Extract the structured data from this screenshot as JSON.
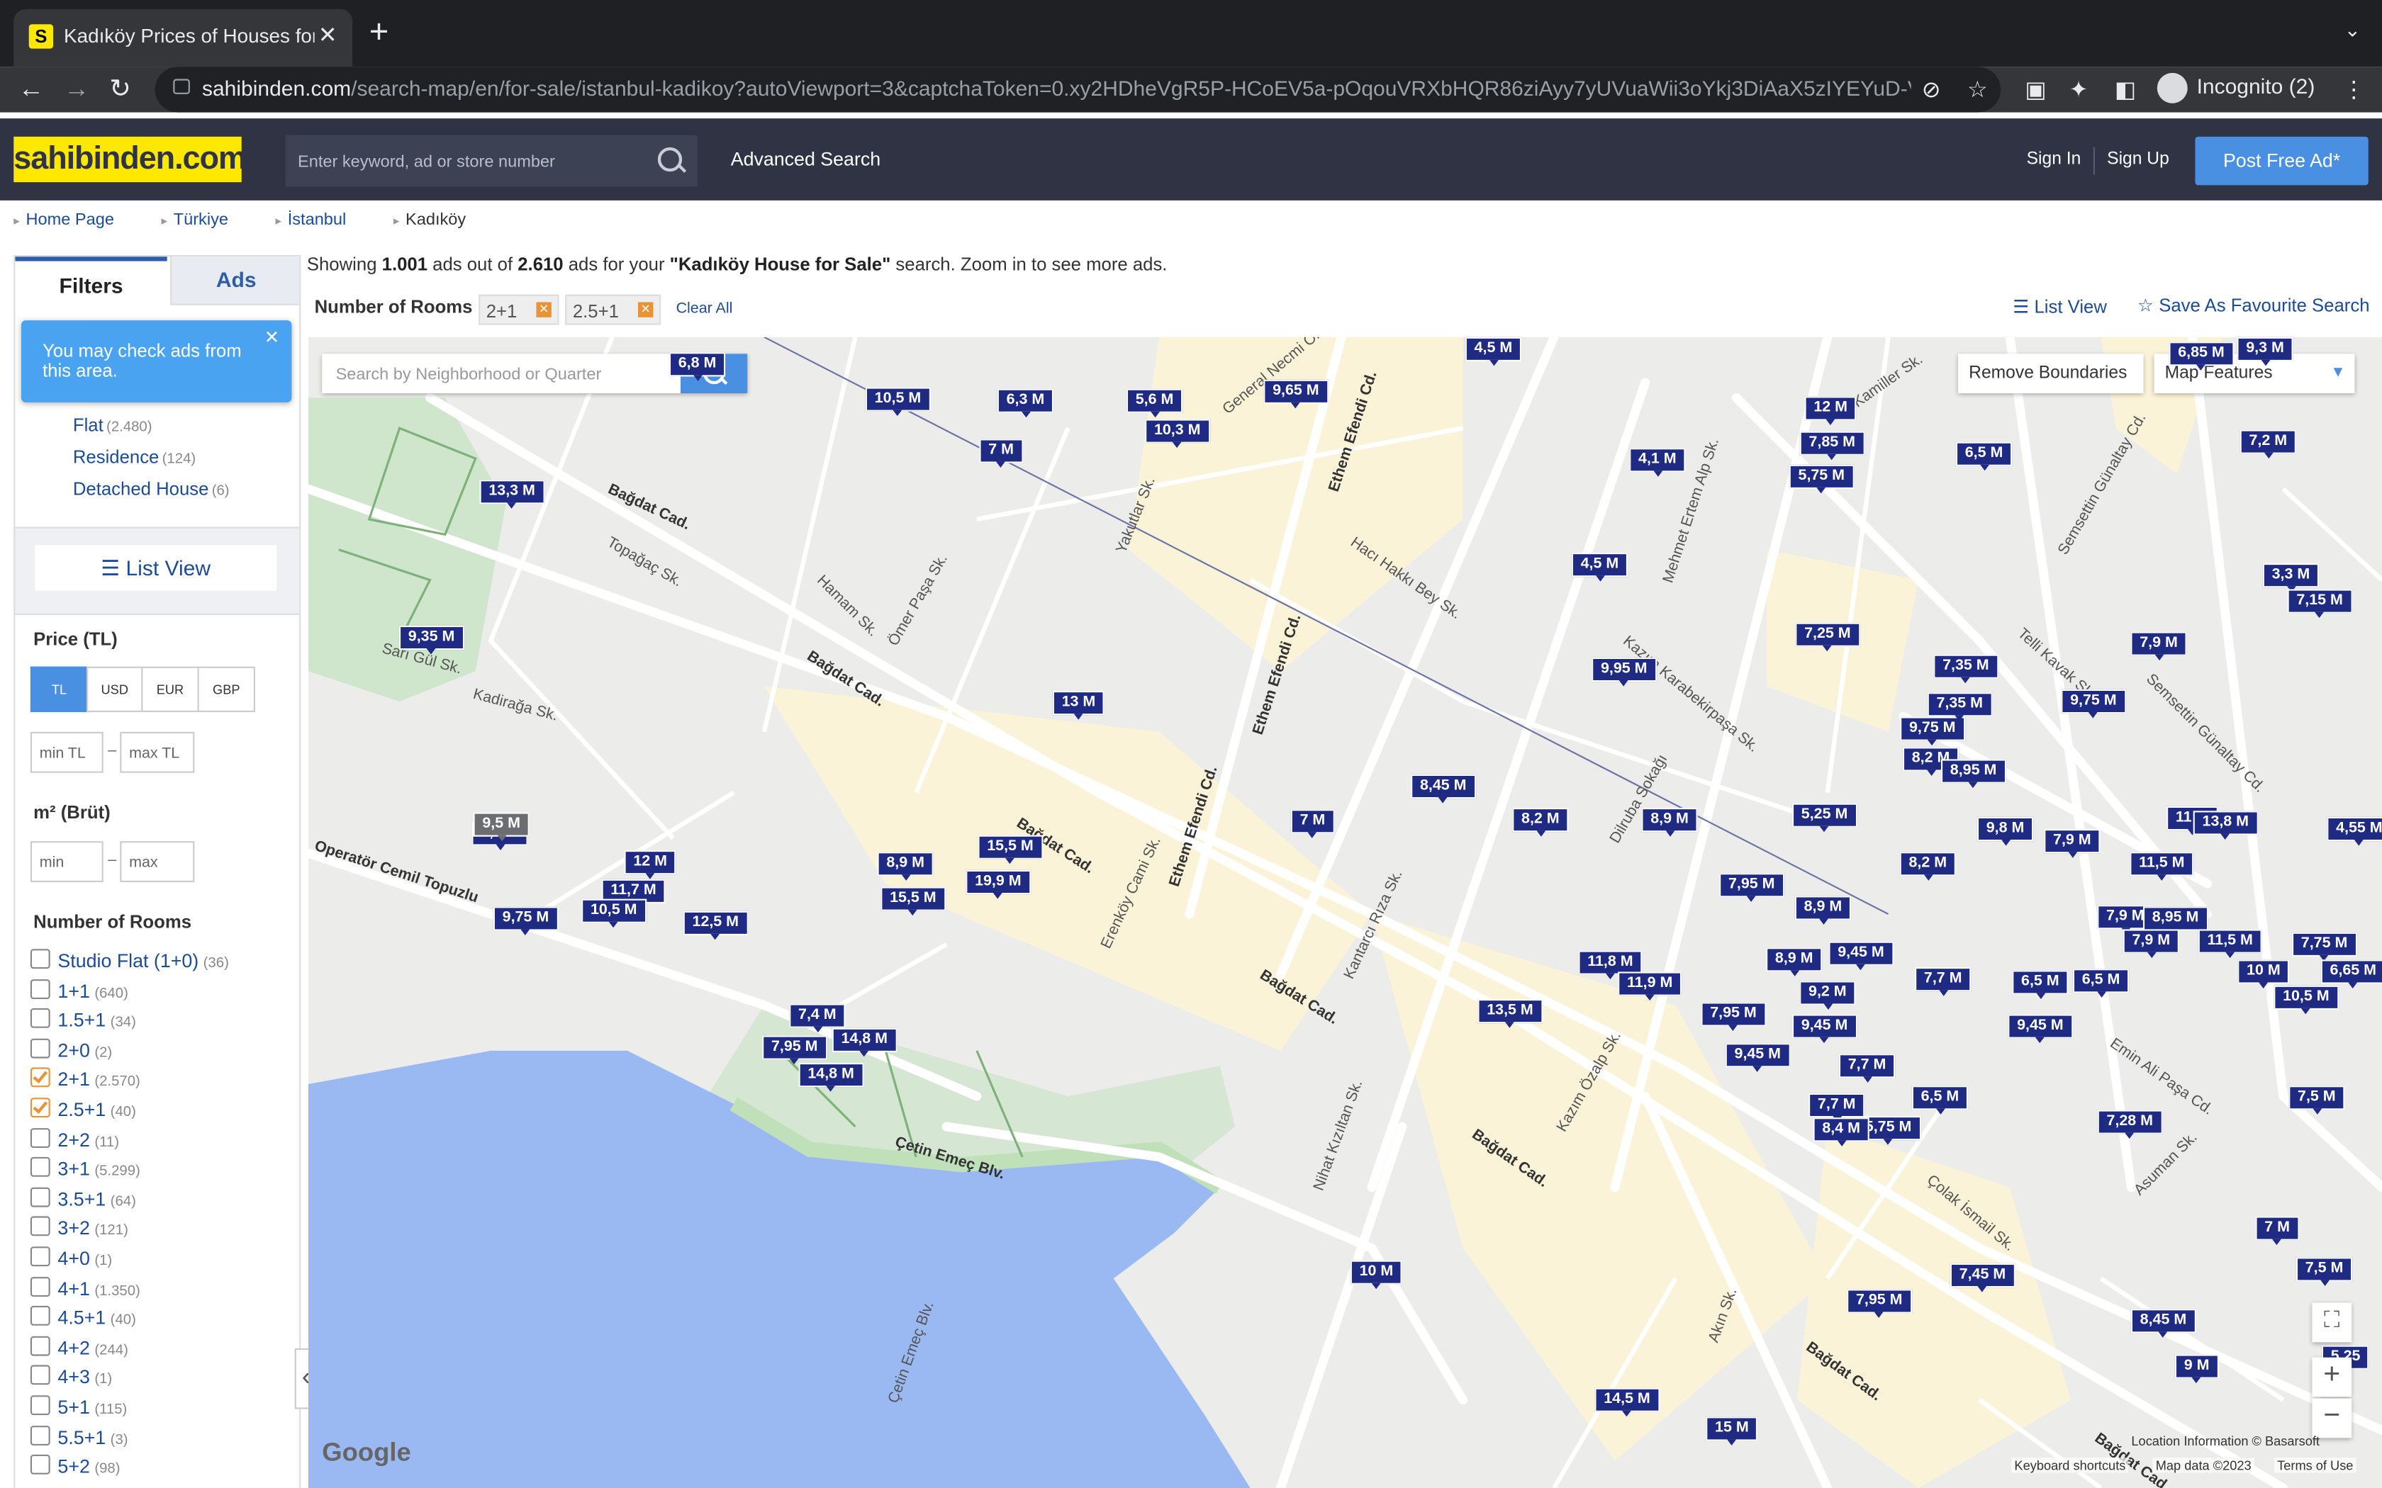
{
  "browser": {
    "tab_title": "Kadıköy Prices of Houses for Sale",
    "tab_favicon": "S",
    "url_domain": "sahibinden.com",
    "url_rest": "/search-map/en/for-sale/istanbul-kadikoy?autoViewport=3&captchaToken=0.xy2HDheVgR5P-HCoEV5a-pOqouVRXbHQR86ziAyy7yUVuaWii3oYkj3DiAaX5zIYEYuD-V...",
    "profile_label": "Incognito (2)"
  },
  "site": {
    "logo": "sahibinden.com",
    "search_placeholder": "Enter keyword, ad or store number",
    "advanced_search": "Advanced Search",
    "sign_in": "Sign In",
    "sign_up": "Sign Up",
    "post_ad": "Post Free Ad*",
    "brand_color": "#ffe800",
    "header_color": "#2f3344"
  },
  "breadcrumb": [
    "Home Page",
    "Türkiye",
    "İstanbul",
    "Kadıköy"
  ],
  "filters": {
    "tab_filters": "Filters",
    "tab_ads": "Ads",
    "tooltip": "You may check ads from this area.",
    "categories": [
      {
        "label": "Flat",
        "count": "(2.480)"
      },
      {
        "label": "Residence",
        "count": "(124)"
      },
      {
        "label": "Detached House",
        "count": "(6)"
      }
    ],
    "list_view": "List View",
    "price_label": "Price (TL)",
    "currencies": [
      "TL",
      "USD",
      "EUR",
      "GBP"
    ],
    "selected_currency": "TL",
    "min_tl": "min TL",
    "max_tl": "max TL",
    "area_label": "m² (Brüt)",
    "min": "min",
    "max": "max",
    "rooms_label": "Number of Rooms",
    "rooms": [
      {
        "label": "Studio Flat (1+0)",
        "count": "(36)",
        "checked": false
      },
      {
        "label": "1+1",
        "count": "(640)",
        "checked": false
      },
      {
        "label": "1.5+1",
        "count": "(34)",
        "checked": false
      },
      {
        "label": "2+0",
        "count": "(2)",
        "checked": false
      },
      {
        "label": "2+1",
        "count": "(2.570)",
        "checked": true
      },
      {
        "label": "2.5+1",
        "count": "(40)",
        "checked": true
      },
      {
        "label": "2+2",
        "count": "(11)",
        "checked": false
      },
      {
        "label": "3+1",
        "count": "(5.299)",
        "checked": false
      },
      {
        "label": "3.5+1",
        "count": "(64)",
        "checked": false
      },
      {
        "label": "3+2",
        "count": "(121)",
        "checked": false
      },
      {
        "label": "4+0",
        "count": "(1)",
        "checked": false
      },
      {
        "label": "4+1",
        "count": "(1.350)",
        "checked": false
      },
      {
        "label": "4.5+1",
        "count": "(40)",
        "checked": false
      },
      {
        "label": "4+2",
        "count": "(244)",
        "checked": false
      },
      {
        "label": "4+3",
        "count": "(1)",
        "checked": false
      },
      {
        "label": "5+1",
        "count": "(115)",
        "checked": false
      },
      {
        "label": "5.5+1",
        "count": "(3)",
        "checked": false
      },
      {
        "label": "5+2",
        "count": "(98)",
        "checked": false
      }
    ]
  },
  "results": {
    "showing_pre": "Showing ",
    "shown": "1.001",
    "mid1": " ads out of ",
    "total": "2.610",
    "mid2": " ads for your ",
    "query": "\"Kadıköy House for Sale\"",
    "post": " search. Zoom in to see more ads.",
    "rooms_filter_label": "Number of Rooms",
    "chips": [
      "2+1",
      "2.5+1"
    ],
    "clear_all": "Clear All",
    "list_view": "List View",
    "save_favourite": "Save As Favourite Search"
  },
  "map": {
    "search_placeholder": "Search by Neighborhood or Quarter",
    "remove_boundaries": "Remove Boundaries",
    "map_features": "Map Features",
    "google": "Google",
    "location_info": "Location Information © Basarsoft",
    "keyboard_shortcuts": "Keyboard shortcuts",
    "map_data": "Map data ©2023",
    "terms": "Terms of Use",
    "pins": [
      "10,5 M",
      "6,3 M",
      "5,6 M",
      "9,65 M",
      "7 M",
      "10,3 M",
      "13,3 M",
      "9,35 M",
      "4,1 M",
      "12 M",
      "7,85 M",
      "5,75 M",
      "6,5 M",
      "7,2 M",
      "4,5 M",
      "3,3 M",
      "7,15 M",
      "7,25 M",
      "7,9 M",
      "9,95 M",
      "7,35 M",
      "9,75 M",
      "13 M",
      "7,35 M",
      "9,75 M",
      "8,2 M",
      "8,95 M",
      "8,45 M",
      "7 M",
      "8,2 M",
      "8,9 M",
      "5,25 M",
      "9,8 M",
      "7,9 M",
      "11 M",
      "4,55 M",
      "13,8 M",
      "9,5 M",
      "12 M",
      "11,7 M",
      "10,5 M",
      "9,75 M",
      "12,5 M",
      "8,9 M",
      "15,5 M",
      "19,9 M",
      "15,5 M",
      "7,95 M",
      "8,9 M",
      "8,2 M",
      "11,5 M",
      "7,9 M",
      "8,95 M",
      "11,5 M",
      "7,75 M",
      "7,9 M",
      "9,45 M",
      "11,8 M",
      "11,9 M",
      "8,9 M",
      "7,7 M",
      "6,5 M",
      "6,5 M",
      "10 M",
      "6,65 M",
      "10,5 M",
      "13,5 M",
      "9,2 M",
      "7,95 M",
      "9,45 M",
      "9,45 M",
      "7,4 M",
      "14,8 M",
      "7,95 M",
      "14,8 M",
      "9,45 M",
      "7,7 M",
      "6,5 M",
      "7,5 M",
      "7,7 M",
      "5,75 M",
      "8,4 M",
      "7,28 M",
      "7 M",
      "7,5 M",
      "10 M",
      "7,45 M",
      "7,95 M",
      "8,45 M",
      "9 M",
      "5,25",
      "14,5 M",
      "15 M",
      "6,85 M",
      "9,3 M",
      "4,5 M",
      "6,8 M"
    ],
    "grey_pins": [
      "9,5 M"
    ]
  }
}
